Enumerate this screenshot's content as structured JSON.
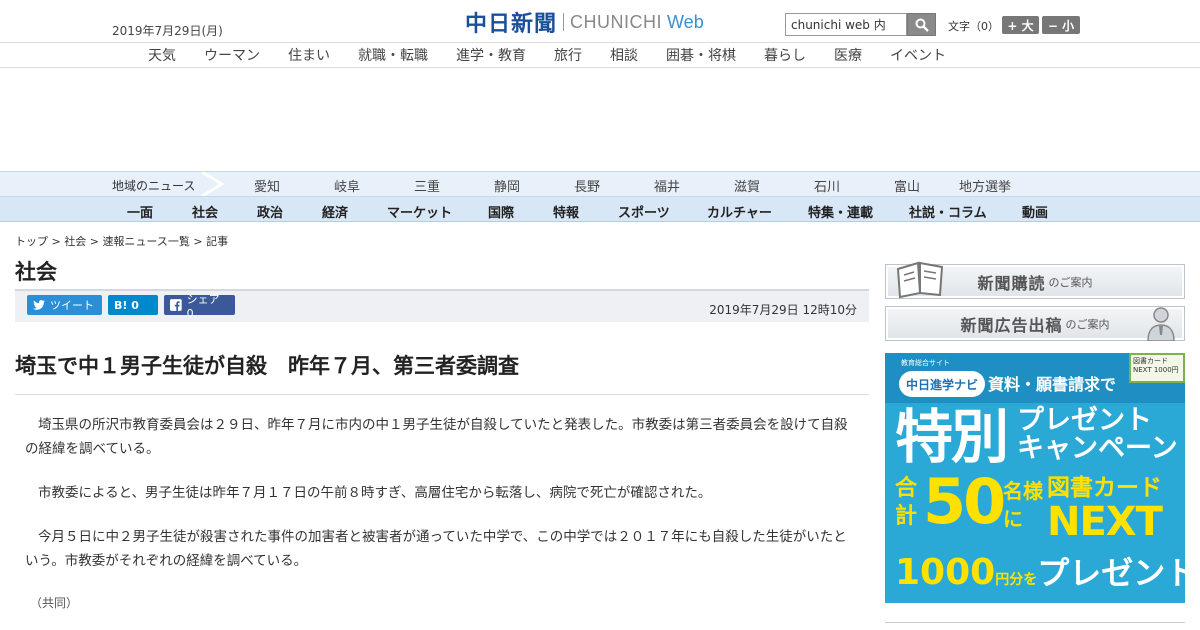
{
  "header": {
    "date": "2019年7月29日(月)",
    "logo_kanji": "中日新聞",
    "logo_latin": "CHUNICHI",
    "logo_web": "Web",
    "search_value": "chunichi web 内",
    "text_size_label": "文字（0）",
    "size_up": "+ 大",
    "size_down": "− 小"
  },
  "category_nav": [
    "天気",
    "ウーマン",
    "住まい",
    "就職・転職",
    "進学・教育",
    "旅行",
    "相談",
    "囲碁・将棋",
    "暮らし",
    "医療",
    "イベント"
  ],
  "region_nav": {
    "label": "地域のニュース",
    "items": [
      "愛知",
      "岐阜",
      "三重",
      "静岡",
      "長野",
      "福井",
      "滋賀",
      "石川",
      "富山",
      "地方選挙"
    ]
  },
  "main_nav": [
    "一面",
    "社会",
    "政治",
    "経済",
    "マーケット",
    "国際",
    "特報",
    "スポーツ",
    "カルチャー",
    "特集・連載",
    "社説・コラム",
    "動画"
  ],
  "breadcrumb": {
    "top": "トップ",
    "section": "社会",
    "list": "速報ニュース一覧",
    "current": "記事",
    "sep": " > "
  },
  "section_title": "社会",
  "share": {
    "tweet": "ツイート",
    "hatena": "B! 0",
    "facebook": "シェア 0"
  },
  "pub_date": "2019年7月29日 12時10分",
  "headline": "埼玉で中１男子生徒が自殺　昨年７月、第三者委調査",
  "article": {
    "paragraphs": [
      "埼玉県の所沢市教育委員会は２９日、昨年７月に市内の中１男子生徒が自殺していたと発表した。市教委は第三者委員会を設けて自殺の経緯を調べている。",
      "市教委によると、男子生徒は昨年７月１７日の午前８時すぎ、高層住宅から転落し、病院で死亡が確認された。",
      "今月５日に中２男子生徒が殺害された事件の加害者と被害者が通っていた中学で、この中学では２０１７年にも自殺した生徒がいたという。市教委がそれぞれの経緯を調べている。"
    ],
    "credit": "（共同）"
  },
  "sidebar": {
    "banner1": {
      "main": "新聞購読",
      "sub": "のご案内"
    },
    "banner2": {
      "main": "新聞広告出稿",
      "sub": "のご案内"
    },
    "promo": {
      "logo_sub": "教育総合サイト",
      "logo": "中日進学ナビ",
      "request": "資料・願書請求で",
      "card": "図書カードNEXT 1000円",
      "big": "特別",
      "right_line1": "プレゼント",
      "right_line2": "キャンペーン",
      "mid_total": "合計",
      "mid_number": "50",
      "mid_people": "名様に",
      "mid_card": "図書カード",
      "mid_next": "NEXT",
      "bottom_amount": "1000",
      "bottom_unit": "円分を",
      "bottom_present": "プレゼント!"
    }
  },
  "colors": {
    "logo_blue": "#1b4f9c",
    "region_bg": "#e8f1fa",
    "main_nav_bg": "#d8e7f5",
    "promo_blue": "#2aa8d6",
    "promo_yellow": "#ffe100"
  }
}
